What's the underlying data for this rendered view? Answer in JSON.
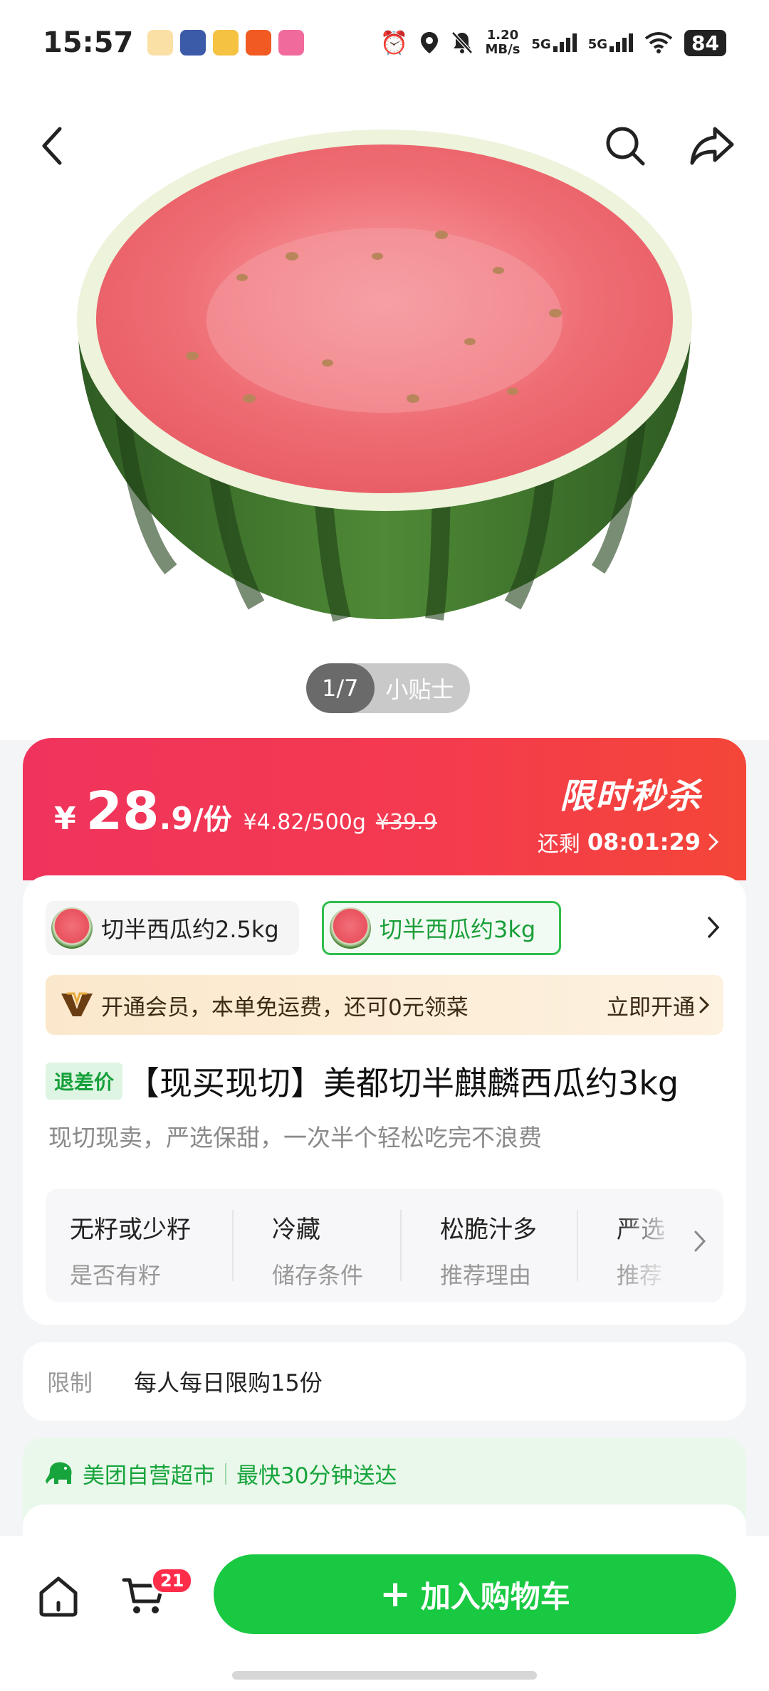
{
  "status_bar": {
    "time": "15:57",
    "net_speed_value": "1.20",
    "net_speed_unit": "MB/s",
    "signal_1": "5G",
    "signal_2": "5G",
    "battery": "84"
  },
  "hero": {
    "pager_count": "1/7",
    "pager_tip": "小贴士"
  },
  "price": {
    "currency": "¥",
    "integer": "28",
    "decimal": ".9",
    "unit": "/份",
    "per_weight": "¥4.82/500g",
    "original": "¥39.9",
    "flash_title": "限时秒杀",
    "remaining_label": "还剩",
    "remaining_time": "08:01:29"
  },
  "variants": [
    {
      "label": "切半西瓜约2.5kg",
      "selected": false
    },
    {
      "label": "切半西瓜约3kg",
      "selected": true
    }
  ],
  "member": {
    "text": "开通会员，本单免运费，还可0元领菜",
    "cta": "立即开通"
  },
  "product": {
    "tag": "退差价",
    "title": "【现买现切】美都切半麒麟西瓜约3kg",
    "subtitle": "现切现卖，严选保甜，一次半个轻松吃完不浪费"
  },
  "attributes": [
    {
      "value": "无籽或少籽",
      "key": "是否有籽"
    },
    {
      "value": "冷藏",
      "key": "储存条件"
    },
    {
      "value": "松脆汁多",
      "key": "推荐理由"
    },
    {
      "value": "严选",
      "key": "推荐"
    }
  ],
  "limit": {
    "label": "限制",
    "text": "每人每日限购15份"
  },
  "store": {
    "name": "美团自营超市",
    "delivery": "最快30分钟送达"
  },
  "bottom": {
    "cart_count": "21",
    "add_cart_plus": "+",
    "add_cart_label": "加入购物车"
  },
  "colors": {
    "price_banner": "#f43a4f",
    "accent_green": "#19c942",
    "badge_red": "#ff2d4a"
  }
}
